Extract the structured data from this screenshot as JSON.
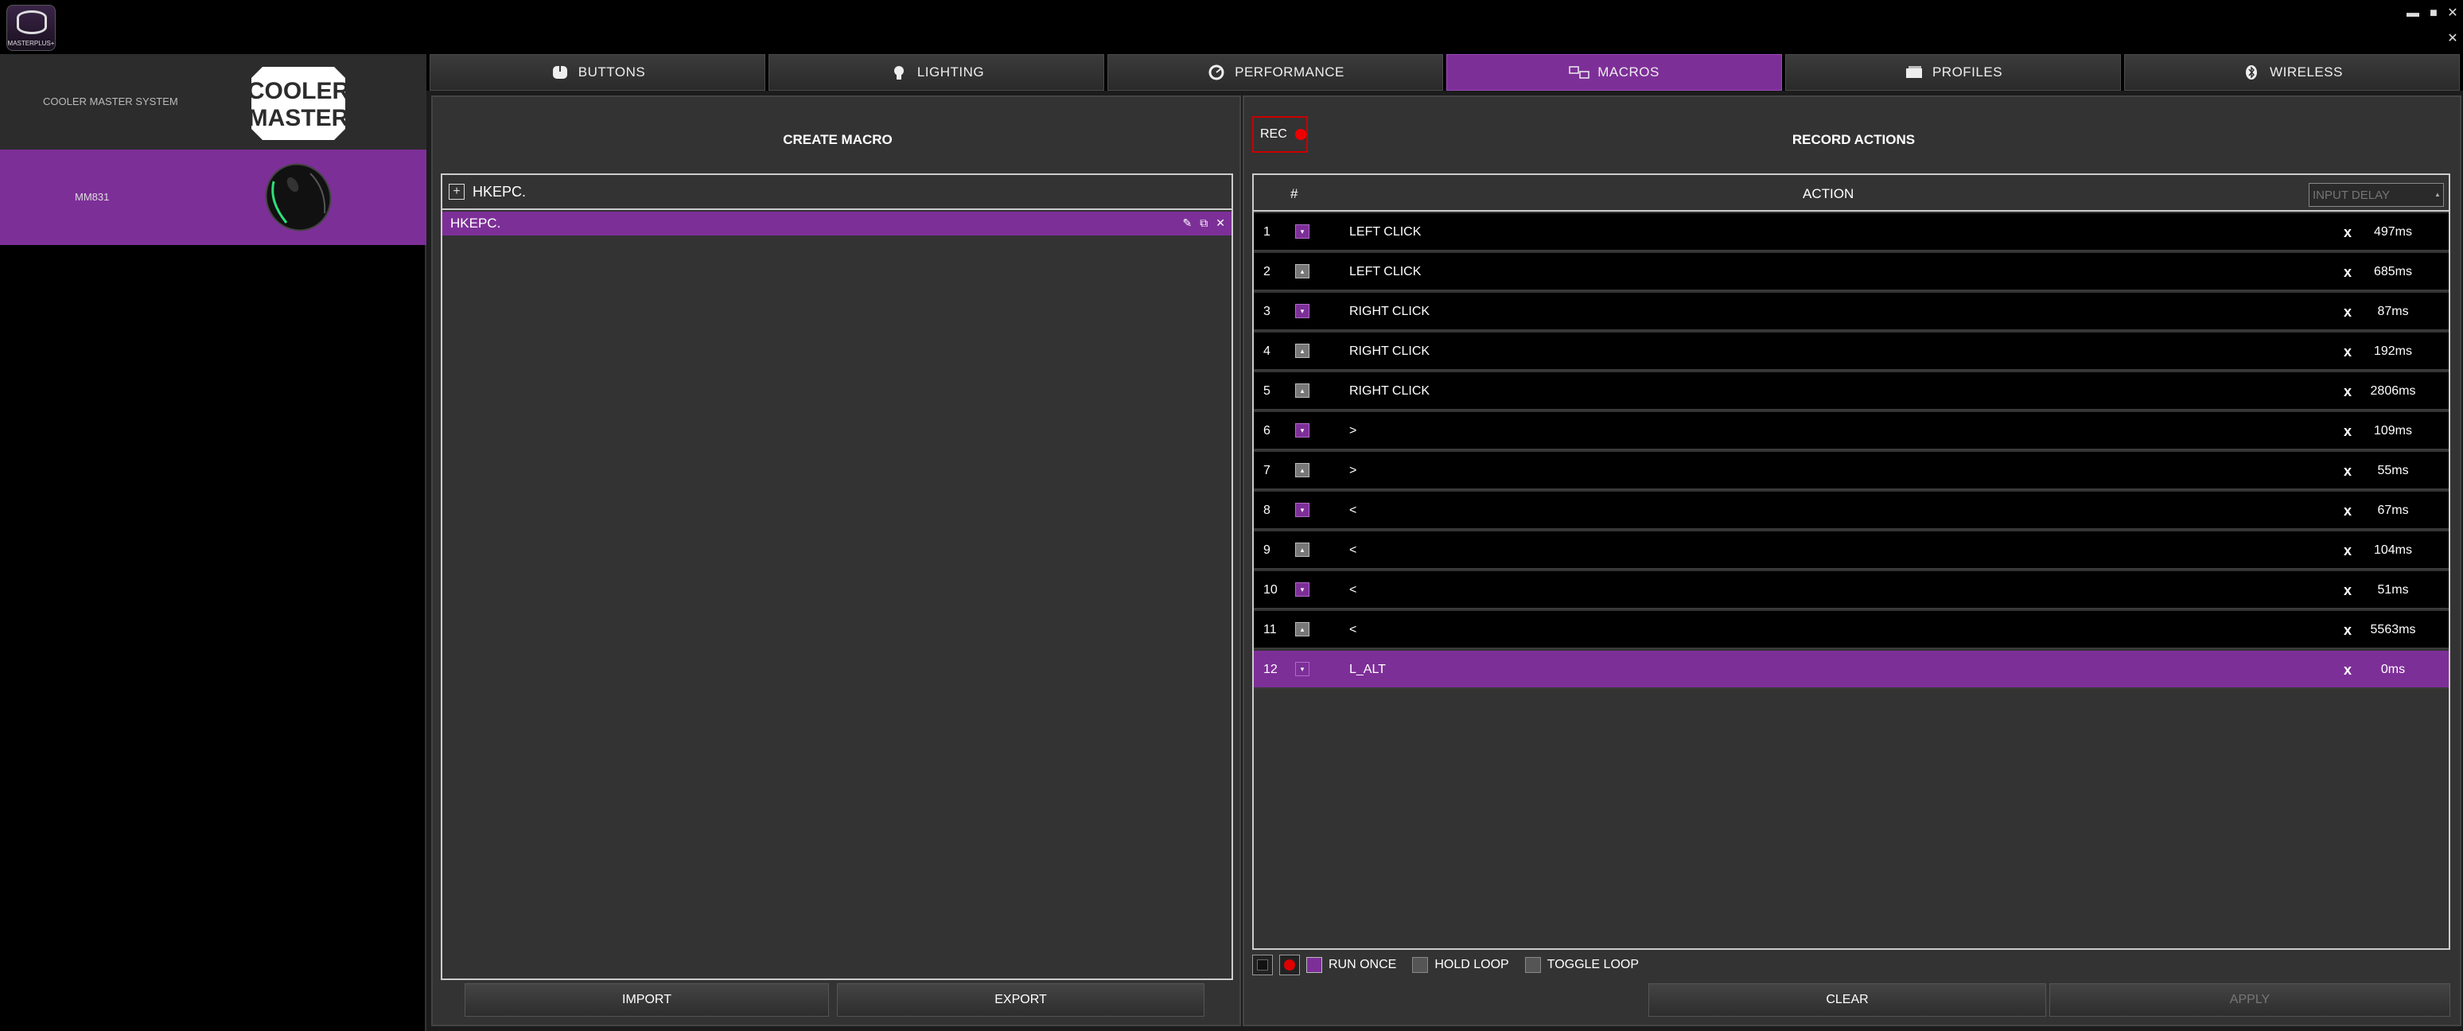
{
  "app": {
    "logo_label": "MASTERPLUS+",
    "controls": {
      "minimize": "▬",
      "maximize": "■",
      "close": "✕",
      "sub_close": "✕"
    }
  },
  "sidebar": {
    "system_label": "COOLER MASTER SYSTEM",
    "brand_logo_text": [
      "COOLER",
      "MASTER"
    ],
    "device_label": "MM831"
  },
  "tabs": [
    {
      "label": "BUTTONS",
      "icon": "mouse-icon"
    },
    {
      "label": "LIGHTING",
      "icon": "bulb-icon"
    },
    {
      "label": "PERFORMANCE",
      "icon": "gauge-icon"
    },
    {
      "label": "MACROS",
      "icon": "macro-keys-icon",
      "active": true
    },
    {
      "label": "PROFILES",
      "icon": "profiles-icon"
    },
    {
      "label": "WIRELESS",
      "icon": "bluetooth-icon"
    }
  ],
  "create_macro": {
    "title": "CREATE MACRO",
    "group_label": "HKEPC.",
    "item_label": "HKEPC.",
    "import_label": "IMPORT",
    "export_label": "EXPORT"
  },
  "record_actions": {
    "title": "RECORD ACTIONS",
    "rec_label": "REC",
    "col_num": "#",
    "col_action": "ACTION",
    "delay_placeholder": "INPUT DELAY",
    "rows": [
      {
        "n": "1",
        "type": "down",
        "action": "LEFT CLICK",
        "delay": "497ms"
      },
      {
        "n": "2",
        "type": "up",
        "action": "LEFT CLICK",
        "delay": "685ms"
      },
      {
        "n": "3",
        "type": "down",
        "action": "RIGHT CLICK",
        "delay": "87ms"
      },
      {
        "n": "4",
        "type": "up",
        "action": "RIGHT CLICK",
        "delay": "192ms"
      },
      {
        "n": "5",
        "type": "up",
        "action": "RIGHT CLICK",
        "delay": "2806ms"
      },
      {
        "n": "6",
        "type": "down",
        "action": ">",
        "delay": "109ms"
      },
      {
        "n": "7",
        "type": "up",
        "action": ">",
        "delay": "55ms"
      },
      {
        "n": "8",
        "type": "down",
        "action": "<",
        "delay": "67ms"
      },
      {
        "n": "9",
        "type": "up",
        "action": "<",
        "delay": "104ms"
      },
      {
        "n": "10",
        "type": "down",
        "action": "<",
        "delay": "51ms"
      },
      {
        "n": "11",
        "type": "up",
        "action": "<",
        "delay": "5563ms"
      },
      {
        "n": "12",
        "type": "down",
        "action": "L_ALT",
        "delay": "0ms",
        "selected": true
      }
    ],
    "delete_label": "x",
    "run_once_label": "RUN ONCE",
    "hold_loop_label": "HOLD LOOP",
    "toggle_loop_label": "TOGGLE LOOP",
    "clear_label": "CLEAR",
    "apply_label": "APPLY"
  },
  "colors": {
    "accent": "#7d2f98",
    "rec": "#e00000"
  }
}
